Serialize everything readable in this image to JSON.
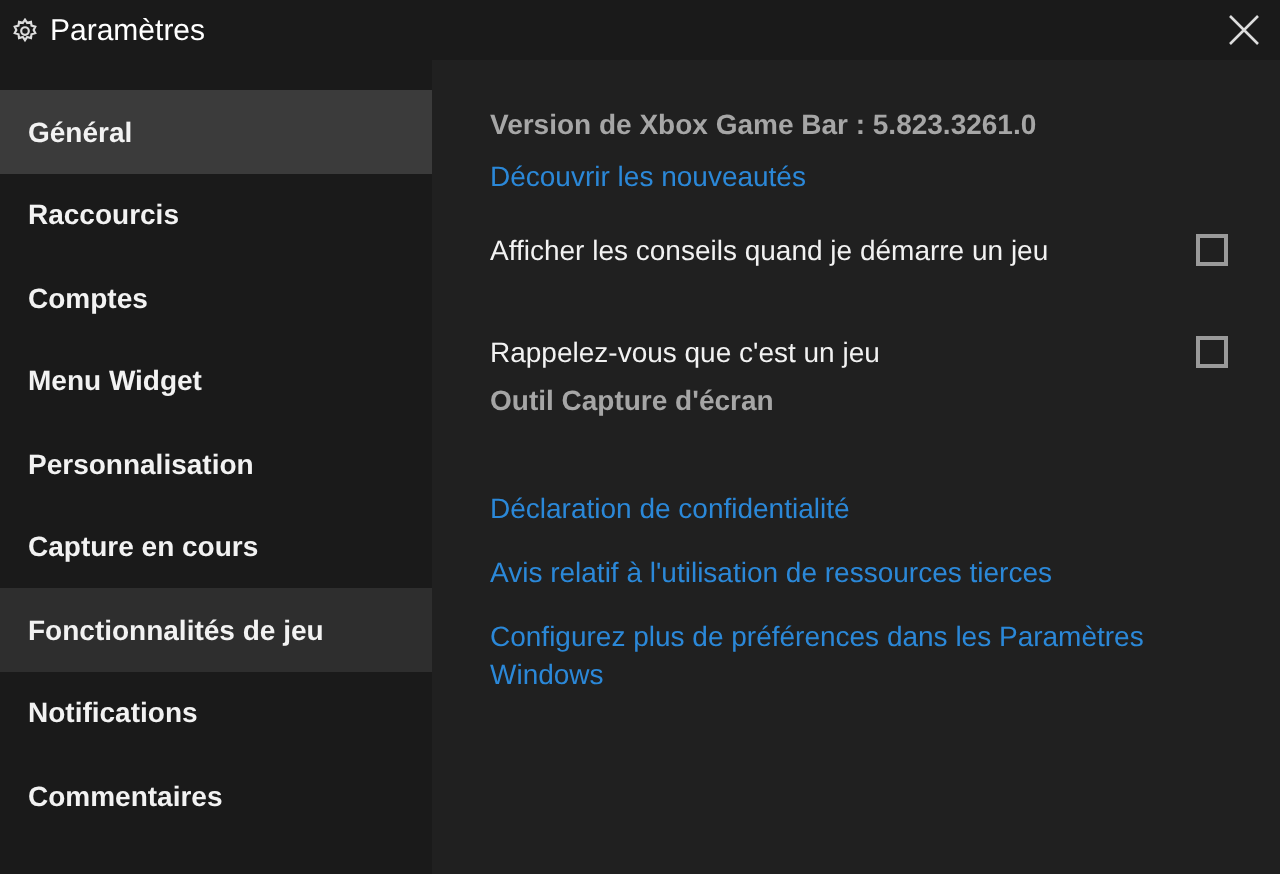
{
  "window": {
    "title": "Paramètres"
  },
  "sidebar": {
    "items": [
      {
        "label": "Général",
        "selected": true,
        "hovered": false
      },
      {
        "label": "Raccourcis",
        "selected": false,
        "hovered": false
      },
      {
        "label": "Comptes",
        "selected": false,
        "hovered": false
      },
      {
        "label": "Menu Widget",
        "selected": false,
        "hovered": false
      },
      {
        "label": "Personnalisation",
        "selected": false,
        "hovered": false
      },
      {
        "label": "Capture en cours",
        "selected": false,
        "hovered": false
      },
      {
        "label": "Fonctionnalités de jeu",
        "selected": false,
        "hovered": true
      },
      {
        "label": "Notifications",
        "selected": false,
        "hovered": false
      },
      {
        "label": "Commentaires",
        "selected": false,
        "hovered": false
      }
    ]
  },
  "content": {
    "version": "Version de Xbox Game Bar : 5.823.3261.0",
    "whats_new_link": "Découvrir les nouveautés",
    "options": [
      {
        "label": "Afficher les conseils quand je démarre un jeu",
        "checked": false
      },
      {
        "label": "Rappelez-vous que c'est un jeu",
        "checked": false,
        "note": "Outil Capture d'écran"
      }
    ],
    "links": [
      "Déclaration de confidentialité",
      "Avis relatif à l'utilisation de ressources tierces",
      "Configurez plus de préférences dans les Paramètres Windows"
    ]
  }
}
